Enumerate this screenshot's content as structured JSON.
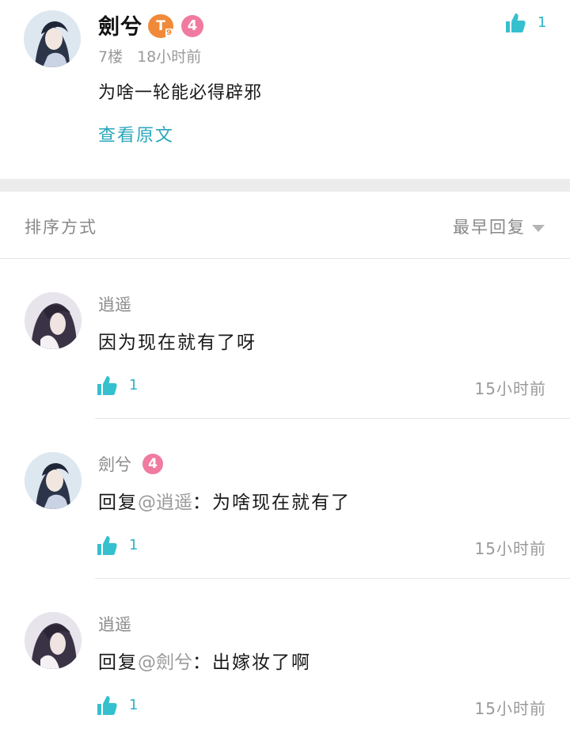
{
  "post": {
    "author": "劍兮",
    "title_badge": "T",
    "title_badge_sub": "9",
    "level": "4",
    "floor": "7楼",
    "time": "18小时前",
    "content": "为啥一轮能必得辟邪",
    "view_original": "查看原文",
    "likes": "1"
  },
  "sort": {
    "label": "排序方式",
    "selected": "最早回复"
  },
  "replies": [
    {
      "author": "逍遥",
      "level": "",
      "prefix": "",
      "mention": "",
      "text": "因为现在就有了呀",
      "likes": "1",
      "time": "15小时前"
    },
    {
      "author": "劍兮",
      "level": "4",
      "prefix": "回复",
      "mention": "@逍遥",
      "text": "：为啥现在就有了",
      "likes": "1",
      "time": "15小时前"
    },
    {
      "author": "逍遥",
      "level": "",
      "prefix": "回复",
      "mention": "@劍兮",
      "text": "：出嫁妆了啊",
      "likes": "1",
      "time": "15小时前"
    }
  ],
  "icons": {
    "like": "thumbs-up-icon",
    "caret": "caret-down-icon"
  },
  "colors": {
    "accent": "#2aa7bb",
    "level_badge": "#f07aa0",
    "title_badge": "#f08a3a"
  }
}
